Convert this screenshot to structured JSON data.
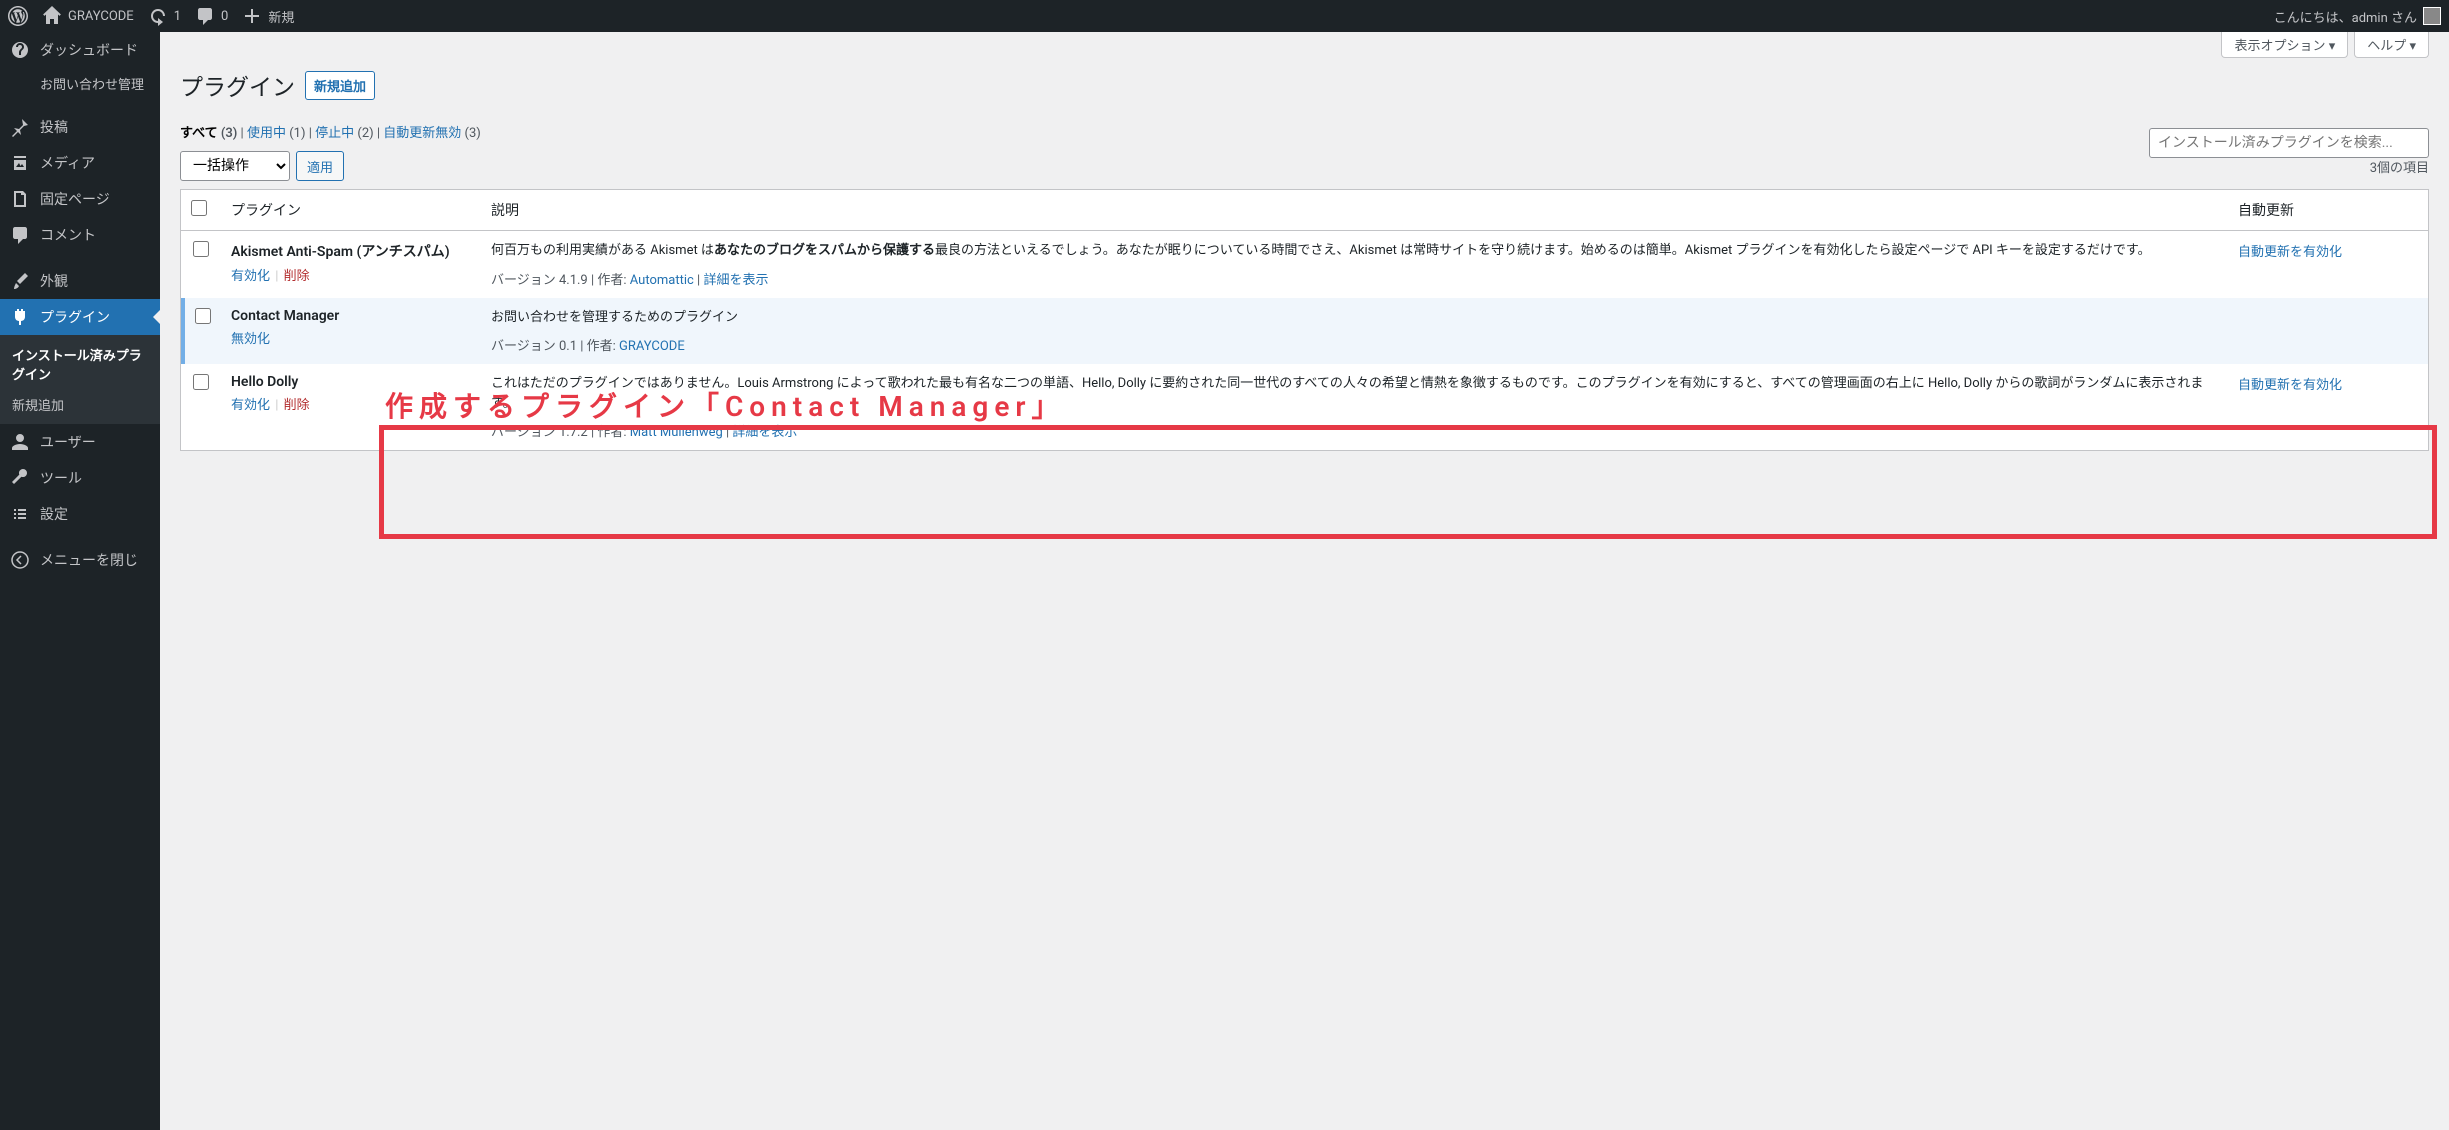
{
  "adminBar": {
    "siteName": "GRAYCODE",
    "updatesCount": "1",
    "commentsCount": "0",
    "new": "新規",
    "greeting": "こんにちは、admin さん"
  },
  "sidebar": {
    "dashboard": "ダッシュボード",
    "contactManage": "お問い合わせ管理",
    "posts": "投稿",
    "media": "メディア",
    "pages": "固定ページ",
    "comments": "コメント",
    "appearance": "外観",
    "plugins": "プラグイン",
    "pluginsInstalled": "インストール済みプラグイン",
    "pluginsAddNew": "新規追加",
    "users": "ユーザー",
    "tools": "ツール",
    "settings": "設定",
    "collapse": "メニューを閉じ"
  },
  "screenMeta": {
    "screenOptions": "表示オプション",
    "help": "ヘルプ"
  },
  "header": {
    "title": "プラグイン",
    "addNew": "新規追加"
  },
  "filters": {
    "all": "すべて",
    "allCount": "(3)",
    "active": "使用中",
    "activeCount": "(1)",
    "inactive": "停止中",
    "inactiveCount": "(2)",
    "autoOff": "自動更新無効",
    "autoOffCount": "(3)"
  },
  "bulk": {
    "label": "一括操作",
    "apply": "適用"
  },
  "search": {
    "placeholder": "インストール済みプラグインを検索..."
  },
  "pagination": {
    "itemsCount": "3個の項目"
  },
  "columns": {
    "plugin": "プラグイン",
    "description": "説明",
    "autoUpdate": "自動更新"
  },
  "actions": {
    "activate": "有効化",
    "deactivate": "無効化",
    "delete": "削除",
    "enableAuto": "自動更新を有効化"
  },
  "plugins": [
    {
      "name": "Akismet Anti-Spam (アンチスパム)",
      "desc_pre": "何百万もの利用実績がある Akismet は",
      "desc_bold": "あなたのブログをスパムから保護する",
      "desc_post": "最良の方法といえるでしょう。あなたが眠りについている時間でさえ、Akismet は常時サイトを守り続けます。始めるのは簡単。Akismet プラグインを有効化したら設定ページで API キーを設定するだけです。",
      "version": "バージョン 4.1.9",
      "authorLabel": "作者:",
      "author": "Automattic",
      "detailLink": "詳細を表示"
    },
    {
      "name": "Contact Manager",
      "desc": "お問い合わせを管理するためのプラグイン",
      "version": "バージョン 0.1",
      "authorLabel": "作者:",
      "author": "GRAYCODE"
    },
    {
      "name": "Hello Dolly",
      "desc": "これはただのプラグインではありません。Louis Armstrong によって歌われた最も有名な二つの単語、Hello, Dolly に要約された同一世代のすべての人々の希望と情熱を象徴するものです。このプラグインを有効にすると、すべての管理画面の右上に Hello, Dolly からの歌詞がランダムに表示されます。",
      "version": "バージョン 1.7.2",
      "authorLabel": "作者:",
      "author": "Matt Mullenweg",
      "detailLink": "詳細を表示"
    }
  ],
  "annotation": {
    "label": "作成するプラグイン「Contact Manager」"
  }
}
